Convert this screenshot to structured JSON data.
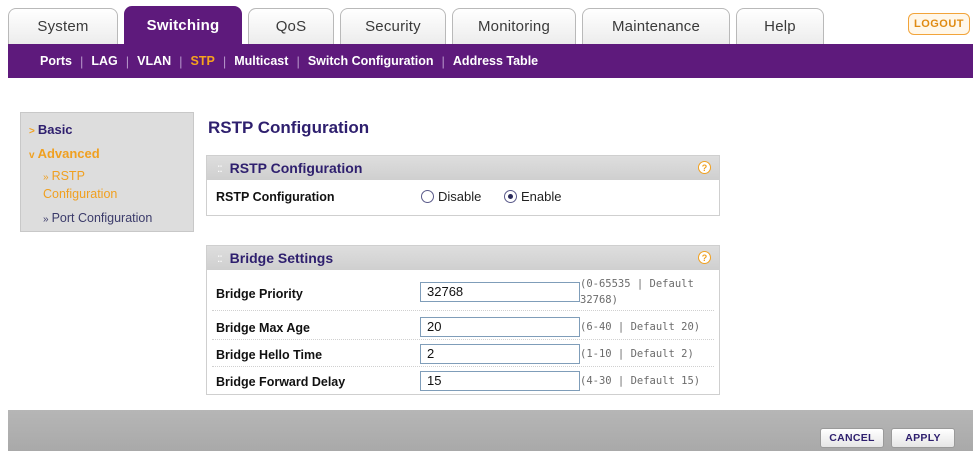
{
  "top_tabs": [
    {
      "label": "System",
      "active": false
    },
    {
      "label": "Switching",
      "active": true
    },
    {
      "label": "QoS",
      "active": false
    },
    {
      "label": "Security",
      "active": false
    },
    {
      "label": "Monitoring",
      "active": false
    },
    {
      "label": "Maintenance",
      "active": false
    },
    {
      "label": "Help",
      "active": false
    }
  ],
  "logout_label": "LOGOUT",
  "sub_nav": [
    {
      "label": "Ports",
      "active": false
    },
    {
      "label": "LAG",
      "active": false
    },
    {
      "label": "VLAN",
      "active": false
    },
    {
      "label": "STP",
      "active": true
    },
    {
      "label": "Multicast",
      "active": false
    },
    {
      "label": "Switch Configuration",
      "active": false
    },
    {
      "label": "Address Table",
      "active": false
    }
  ],
  "sidebar": {
    "basic": "Basic",
    "advanced": "Advanced",
    "rstp_line1": "RSTP",
    "rstp_line2": "Configuration",
    "port_configuration": "Port Configuration"
  },
  "page_title": "RSTP Configuration",
  "rstp_panel": {
    "title": "RSTP Configuration",
    "row_label": "RSTP Configuration",
    "options": [
      {
        "label": "Disable",
        "selected": false
      },
      {
        "label": "Enable",
        "selected": true
      }
    ]
  },
  "bridge_panel": {
    "title": "Bridge Settings",
    "rows": [
      {
        "label": "Bridge Priority",
        "value": "32768",
        "hint_line1": "(0-65535 | Default",
        "hint_line2": "32768)"
      },
      {
        "label": "Bridge Max Age",
        "value": "20",
        "hint_line1": "(6-40 | Default 20)",
        "hint_line2": ""
      },
      {
        "label": "Bridge Hello Time",
        "value": "2",
        "hint_line1": "(1-10 | Default 2)",
        "hint_line2": ""
      },
      {
        "label": "Bridge Forward Delay",
        "value": "15",
        "hint_line1": "(4-30 | Default 15)",
        "hint_line2": ""
      }
    ]
  },
  "buttons": {
    "cancel": "CANCEL",
    "apply": "APPLY"
  },
  "colors": {
    "nav_purple": "#5e1a7c",
    "accent_orange": "#f0a020",
    "title_navy": "#2e1f6e"
  }
}
